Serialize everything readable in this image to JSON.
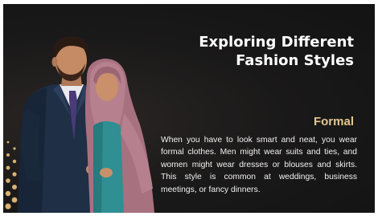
{
  "slide": {
    "title": "Exploring Different Fashion Styles",
    "subtitle": "Formal",
    "body": "When you have to look smart and neat, you wear formal clothes. Men might wear suits and ties, and women might wear dresses or blouses and skirts. This style is common at weddings, business meetings, or fancy dinners."
  },
  "colors": {
    "background": "#161616",
    "title": "#ffffff",
    "accent": "#e5c68f",
    "body_text": "#f2f2f2",
    "suit": "#1f2f46",
    "hijab": "#b7808e",
    "dress": "#2f8f92",
    "dots": "#d8b272"
  },
  "icons": {
    "illustration": "couple-formal-illustration",
    "decoration": "gold-dots-pattern"
  }
}
